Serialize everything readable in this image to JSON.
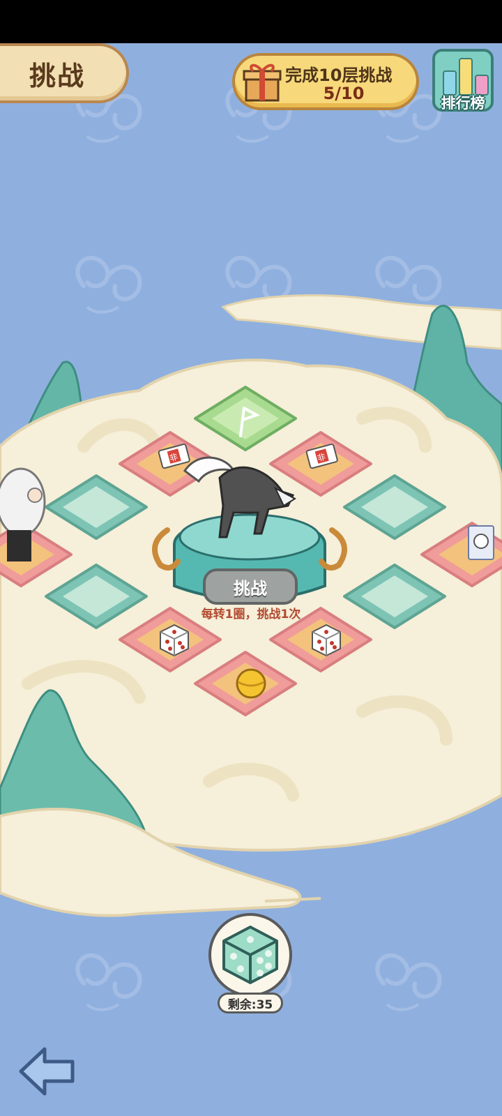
{
  "header": {
    "title": "挑战"
  },
  "task": {
    "title": "完成10层挑战",
    "progress_text": "5/10",
    "progress": 0.5
  },
  "leaderboard": {
    "label": "排行榜"
  },
  "board": {
    "challenge_label": "挑战",
    "challenge_hint": "每转1圈，挑战1次",
    "coupon_text": "非"
  },
  "dice": {
    "remaining_text": "剩余:35",
    "remaining": 35
  },
  "colors": {
    "background": "#8fb0df",
    "tile_pink": "#ee9f9d",
    "tile_teal": "#7fc5b6",
    "tile_green": "#a9dc92"
  }
}
